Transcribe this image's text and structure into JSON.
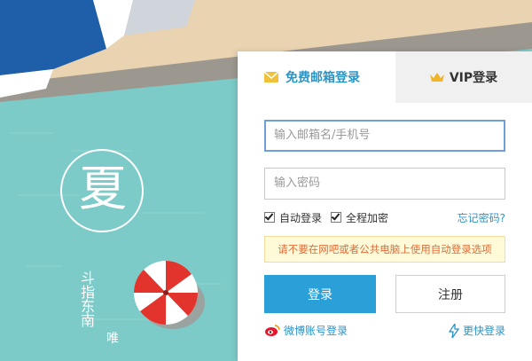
{
  "tabs": {
    "email": {
      "label": "免费邮箱登录",
      "icon": "envelope-icon"
    },
    "vip": {
      "label": "VIP登录",
      "icon": "crown-icon"
    }
  },
  "form": {
    "account_placeholder": "输入邮箱名/手机号",
    "password_placeholder": "输入密码",
    "auto_login": "自动登录",
    "encrypt": "全程加密",
    "forgot": "忘记密码?",
    "notice": "请不要在网吧或者公共电脑上使用自动登录选项"
  },
  "buttons": {
    "login": "登录",
    "register": "注册"
  },
  "footer": {
    "weibo": "微博账号登录",
    "faster": "更快登录"
  },
  "background": {
    "badge_char": "夏",
    "vertical_text": "斗指东南",
    "vertical_text2": "唯"
  },
  "colors": {
    "accent": "#2a9fd8",
    "teal_bg": "#7cc9c6",
    "sand_bg": "#e8d2b0"
  }
}
